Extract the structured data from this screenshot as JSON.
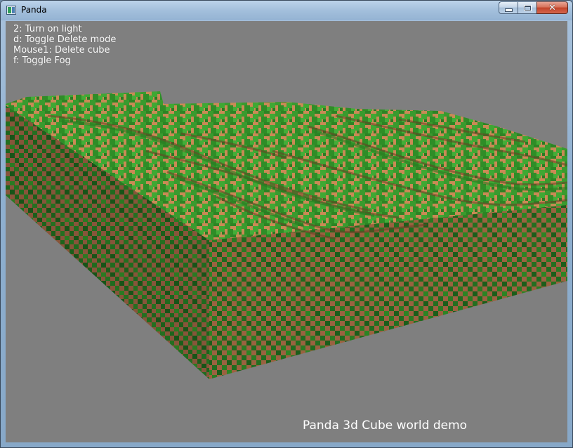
{
  "window": {
    "title": "Panda",
    "controls": {
      "minimize_icon": "minimize-icon",
      "maximize_icon": "maximize-icon",
      "close_icon": "close-icon"
    }
  },
  "help": {
    "lines": [
      "2: Turn on light",
      "d: Toggle Delete mode",
      "Mouse1: Delete cube",
      "f: Toggle Fog"
    ]
  },
  "caption": "Panda 3d Cube world demo",
  "colors": {
    "background": "#7f7f7f",
    "grass_light": "#3a9a2e",
    "grass_dark": "#1f6b1e",
    "dirt": "#c98a55",
    "dirt_dark": "#8e5a3a",
    "text": "#ffffff"
  }
}
